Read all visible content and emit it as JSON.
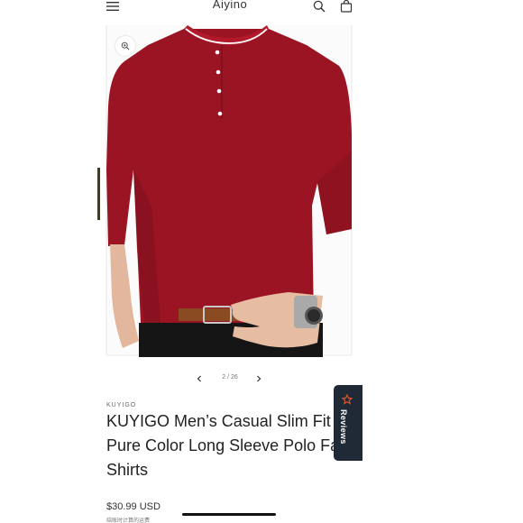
{
  "header": {
    "store_name": "Aiyino",
    "menu_icon": "hamburger-menu-icon",
    "search_icon": "search-icon",
    "cart_icon": "cart-bag-icon"
  },
  "gallery": {
    "zoom_icon": "zoom-in-icon",
    "image_desc_icon": "product-photo-red-henley-shirt",
    "pagination": "2 / 26",
    "prev_icon": "chevron-left-icon",
    "next_icon": "chevron-right-icon"
  },
  "product": {
    "vendor": "KUYIGO",
    "title": "KUYIGO Men’s Casual Slim Fit Shirts Pure Color Long Sleeve Polo Fashion T-Shirts",
    "price": "$30.99 USD",
    "tax_note": "结账时计算的运费"
  },
  "reviews_tab": {
    "label": "Reviews",
    "icon": "star-icon"
  },
  "colors": {
    "shirt": "#9b1424",
    "tab_bg": "#1f2a36",
    "star": "#e8572a"
  }
}
